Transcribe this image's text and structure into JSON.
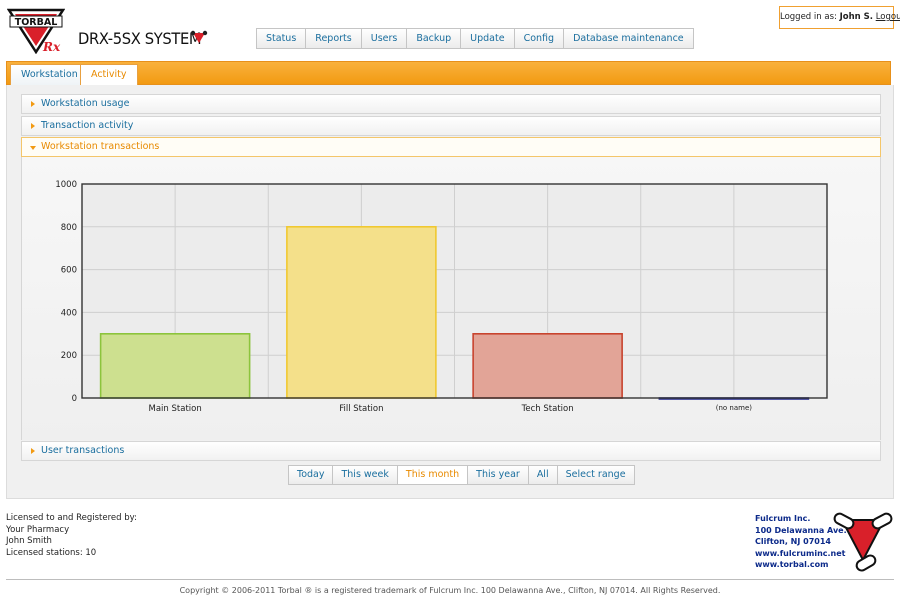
{
  "header": {
    "logo_text": "TORBAL",
    "logo_mark": "Rx",
    "system_title": "DRX-5SX SYSTEM",
    "nav": [
      "Status",
      "Reports",
      "Users",
      "Backup",
      "Update",
      "Config",
      "Database maintenance"
    ],
    "login": {
      "prefix": "Logged in as:",
      "user": "John S.",
      "logout": "Logout"
    }
  },
  "tabs": [
    {
      "label": "Workstation",
      "active": false
    },
    {
      "label": "Activity",
      "active": true
    }
  ],
  "accordion": {
    "workstation_usage": "Workstation usage",
    "transaction_activity": "Transaction activity",
    "workstation_transactions": "Workstation transactions",
    "user_transactions": "User transactions"
  },
  "chart_data": {
    "type": "bar",
    "categories": [
      "Main Station",
      "Fill Station",
      "Tech Station",
      "(no name)"
    ],
    "values": [
      300,
      800,
      300,
      0
    ],
    "colors": {
      "fill": [
        "#cde08f",
        "#f4e08a",
        "#e2a497",
        "#9aa0c8"
      ],
      "stroke": [
        "#8cc43c",
        "#f0c830",
        "#c8442e",
        "#2a3090"
      ]
    },
    "yticks": [
      "0",
      "200",
      "400",
      "600",
      "800",
      "1000"
    ],
    "ylim": [
      0,
      1000
    ],
    "grid": true
  },
  "range_buttons": [
    {
      "label": "Today",
      "active": false
    },
    {
      "label": "This week",
      "active": false
    },
    {
      "label": "This month",
      "active": true
    },
    {
      "label": "This year",
      "active": false
    },
    {
      "label": "All",
      "active": false
    },
    {
      "label": "Select range",
      "active": false
    }
  ],
  "license": {
    "heading": "Licensed to and Registered by:",
    "pharmacy": "Your Pharmacy",
    "name": "John Smith",
    "stations": "Licensed stations: 10"
  },
  "company": {
    "name": "Fulcrum Inc.",
    "address1": "100 Delawanna Ave.",
    "address2": "Clifton, NJ 07014",
    "web1": "www.fulcruminc.net",
    "web2": "www.torbal.com"
  },
  "copyright": "Copyright © 2006-2011 Torbal ® is a registered trademark of Fulcrum Inc. 100 Delawanna Ave., Clifton, NJ 07014. All Rights Reserved."
}
